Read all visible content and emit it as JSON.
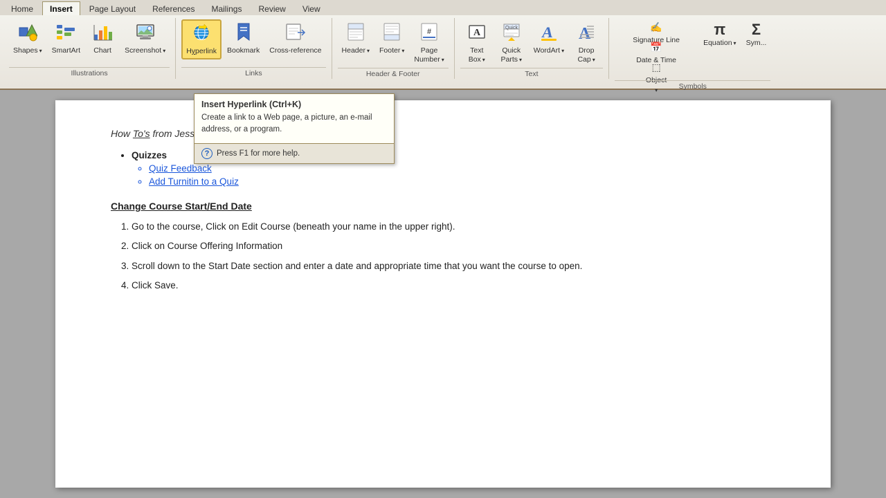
{
  "ribbon": {
    "tabs": [
      {
        "label": "Home",
        "active": false
      },
      {
        "label": "Insert",
        "active": true
      },
      {
        "label": "Page Layout",
        "active": false
      },
      {
        "label": "References",
        "active": false
      },
      {
        "label": "Mailings",
        "active": false
      },
      {
        "label": "Review",
        "active": false
      },
      {
        "label": "View",
        "active": false
      }
    ],
    "groups": {
      "illustrations": {
        "label": "Illustrations",
        "buttons": [
          {
            "id": "shapes",
            "icon": "⬛",
            "label": "Shapes",
            "dropdown": true
          },
          {
            "id": "smartart",
            "icon": "📊",
            "label": "SmartArt",
            "dropdown": false
          },
          {
            "id": "chart",
            "icon": "📈",
            "label": "Chart",
            "dropdown": false
          },
          {
            "id": "screenshot",
            "icon": "🖼",
            "label": "Screenshot",
            "dropdown": true
          }
        ]
      },
      "links": {
        "label": "Links",
        "buttons": [
          {
            "id": "hyperlink",
            "icon": "🌐",
            "label": "Hyperlink",
            "active": true
          },
          {
            "id": "bookmark",
            "icon": "🔖",
            "label": "Bookmark",
            "dropdown": false
          },
          {
            "id": "crossref",
            "icon": "📋",
            "label": "Cross-reference",
            "dropdown": false
          }
        ]
      },
      "header_footer": {
        "label": "Header & Footer",
        "buttons": [
          {
            "id": "header",
            "icon": "▬",
            "label": "Header",
            "dropdown": true
          },
          {
            "id": "footer",
            "icon": "▬",
            "label": "Footer",
            "dropdown": true
          },
          {
            "id": "pagenumber",
            "icon": "#",
            "label": "Page\nNumber",
            "dropdown": true
          }
        ]
      },
      "text": {
        "label": "Text",
        "buttons": [
          {
            "id": "textbox",
            "icon": "A",
            "label": "Text\nBox",
            "dropdown": true
          },
          {
            "id": "quickparts",
            "icon": "⚡",
            "label": "Quick\nParts",
            "dropdown": true
          },
          {
            "id": "wordart",
            "icon": "A",
            "label": "WordArt",
            "dropdown": true
          },
          {
            "id": "dropcap",
            "icon": "A",
            "label": "Drop\nCap",
            "dropdown": true
          }
        ]
      },
      "symbols": {
        "label": "Symbols",
        "buttons": [
          {
            "id": "signatureline",
            "icon": "✍",
            "label": "Signature Line",
            "dropdown": true
          },
          {
            "id": "datetime",
            "icon": "📅",
            "label": "Date & Time",
            "dropdown": false
          },
          {
            "id": "object",
            "icon": "⬚",
            "label": "Object",
            "dropdown": true
          },
          {
            "id": "equation",
            "icon": "π",
            "label": "Equation",
            "dropdown": false
          },
          {
            "id": "symbol",
            "icon": "Ω",
            "label": "Sym...",
            "dropdown": false
          }
        ]
      }
    }
  },
  "tooltip": {
    "title": "Insert Hyperlink (Ctrl+K)",
    "body": "Create a link to a Web page, a picture, an e-mail address, or a program.",
    "help": "Press F1 for more help."
  },
  "document": {
    "intro": "How To's from Jessica's Emails",
    "sections": [
      {
        "title": "Quizzes",
        "items": [
          {
            "text": "Quiz Feedback",
            "link": true
          },
          {
            "text": "Add Turnitin to a Quiz",
            "link": true
          }
        ]
      }
    ],
    "bold_heading": "Change Course Start/End Date",
    "steps": [
      "Go to the course, Click on Edit Course (beneath your name in the upper right).",
      "Click on Course Offering Information",
      "Scroll down to the Start Date section and enter a date and appropriate time that you want the course to open.",
      "Click Save."
    ]
  }
}
